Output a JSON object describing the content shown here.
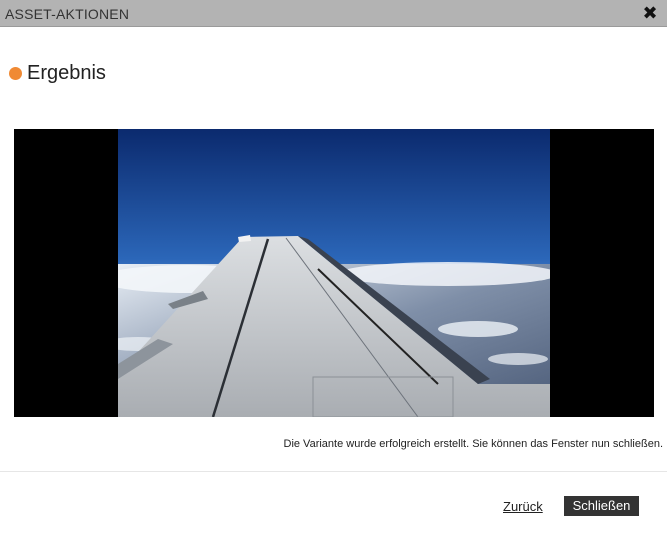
{
  "window": {
    "title": "ASSET-AKTIONEN",
    "close_icon": "close-x-icon"
  },
  "result": {
    "heading": "Ergebnis",
    "bullet_color": "#f08a34",
    "image_subject": "airplane wing above clouds, blue sky"
  },
  "message": "Die Variante wurde erfolgreich erstellt. Sie können das Fenster nun schließen.",
  "footer": {
    "back_label": "Zurück",
    "close_label": "Schließen"
  }
}
